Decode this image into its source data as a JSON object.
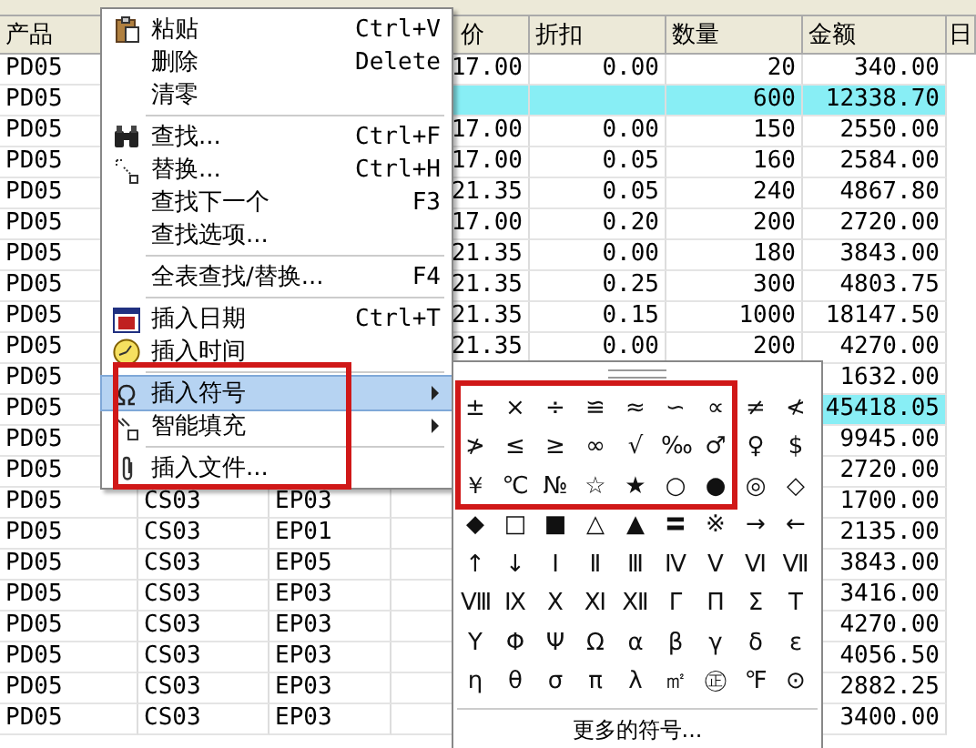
{
  "table": {
    "columns": [
      "产品",
      "",
      "",
      "价",
      "折扣",
      "数量",
      "金额",
      "日"
    ],
    "rows": [
      {
        "product": "PD05",
        "price": "17.00",
        "discount": "0.00",
        "qty": "20",
        "amount": "340.00",
        "highlighted": false
      },
      {
        "product": "PD05",
        "qty": "600",
        "amount": "12338.70",
        "highlighted": true
      },
      {
        "product": "PD05",
        "price": "17.00",
        "discount": "0.00",
        "qty": "150",
        "amount": "2550.00",
        "highlighted": false
      },
      {
        "product": "PD05",
        "price": "17.00",
        "discount": "0.05",
        "qty": "160",
        "amount": "2584.00",
        "highlighted": false
      },
      {
        "product": "PD05",
        "price": "21.35",
        "discount": "0.05",
        "qty": "240",
        "amount": "4867.80",
        "highlighted": false
      },
      {
        "product": "PD05",
        "price": "17.00",
        "discount": "0.20",
        "qty": "200",
        "amount": "2720.00",
        "highlighted": false
      },
      {
        "product": "PD05",
        "price": "21.35",
        "discount": "0.00",
        "qty": "180",
        "amount": "3843.00",
        "highlighted": false
      },
      {
        "product": "PD05",
        "price": "21.35",
        "discount": "0.25",
        "qty": "300",
        "amount": "4803.75",
        "highlighted": false
      },
      {
        "product": "PD05",
        "price": "21.35",
        "discount": "0.15",
        "qty": "1000",
        "amount": "18147.50",
        "highlighted": false
      },
      {
        "product": "PD05",
        "price": "21.35",
        "discount": "0.00",
        "qty": "200",
        "amount": "4270.00",
        "highlighted": false
      },
      {
        "product": "PD05",
        "amount": "1632.00",
        "highlighted": false
      },
      {
        "product": "PD05",
        "amount": "45418.05",
        "highlighted": true
      },
      {
        "product": "PD05",
        "amount": "9945.00",
        "highlighted": false
      },
      {
        "product": "PD05",
        "amount": "2720.00",
        "highlighted": false
      },
      {
        "product": "PD05",
        "col_2": "CS03",
        "col_3": "EP03",
        "amount": "1700.00",
        "highlighted": false
      },
      {
        "product": "PD05",
        "col_2": "CS03",
        "col_3": "EP01",
        "amount": "2135.00",
        "highlighted": false
      },
      {
        "product": "PD05",
        "col_2": "CS03",
        "col_3": "EP05",
        "amount": "3843.00",
        "highlighted": false
      },
      {
        "product": "PD05",
        "col_2": "CS03",
        "col_3": "EP03",
        "amount": "3416.00",
        "highlighted": false
      },
      {
        "product": "PD05",
        "col_2": "CS03",
        "col_3": "EP03",
        "amount": "4270.00",
        "highlighted": false
      },
      {
        "product": "PD05",
        "col_2": "CS03",
        "col_3": "EP03",
        "amount": "4056.50",
        "highlighted": false
      },
      {
        "product": "PD05",
        "col_2": "CS03",
        "col_3": "EP03",
        "amount": "2882.25",
        "highlighted": false
      },
      {
        "product": "PD05",
        "col_2": "CS03",
        "col_3": "EP03",
        "amount": "3400.00",
        "highlighted": false
      }
    ]
  },
  "context_menu": {
    "items": [
      {
        "kind": "item",
        "label": "粘贴",
        "shortcut": "Ctrl+V",
        "submenu": false,
        "selected": false
      },
      {
        "kind": "item",
        "label": "删除",
        "shortcut": "Delete",
        "submenu": false,
        "selected": false
      },
      {
        "kind": "item",
        "label": "清零",
        "submenu": false,
        "selected": false
      },
      {
        "kind": "separator"
      },
      {
        "kind": "item",
        "label": "查找...",
        "shortcut": "Ctrl+F",
        "submenu": false,
        "selected": false
      },
      {
        "kind": "item",
        "label": "替换...",
        "shortcut": "Ctrl+H",
        "submenu": false,
        "selected": false
      },
      {
        "kind": "item",
        "label": "查找下一个",
        "shortcut": "F3",
        "submenu": false,
        "selected": false
      },
      {
        "kind": "item",
        "label": "查找选项...",
        "submenu": false,
        "selected": false
      },
      {
        "kind": "separator"
      },
      {
        "kind": "item",
        "label": "全表查找/替换...",
        "shortcut": "F4",
        "submenu": false,
        "selected": false
      },
      {
        "kind": "separator"
      },
      {
        "kind": "item",
        "label": "插入日期",
        "shortcut": "Ctrl+T",
        "submenu": false,
        "selected": false
      },
      {
        "kind": "item",
        "label": "插入时间",
        "submenu": false,
        "selected": false
      },
      {
        "kind": "separator"
      },
      {
        "kind": "item",
        "label": "插入符号",
        "submenu": true,
        "selected": true
      },
      {
        "kind": "item",
        "label": "智能填充",
        "submenu": true,
        "selected": false
      },
      {
        "kind": "separator"
      },
      {
        "kind": "item",
        "label": "插入文件...",
        "submenu": false,
        "selected": false
      }
    ]
  },
  "symbol_palette": {
    "symbols": [
      "±",
      "×",
      "÷",
      "≌",
      "≈",
      "∽",
      "∝",
      "≠",
      "≮",
      "≯",
      "≤",
      "≥",
      "∞",
      "√",
      "‰",
      "♂",
      "♀",
      "$",
      "￥",
      "℃",
      "№",
      "☆",
      "★",
      "○",
      "●",
      "◎",
      "◇",
      "◆",
      "□",
      "■",
      "△",
      "▲",
      "〓",
      "※",
      "→",
      "←",
      "↑",
      "↓",
      "Ⅰ",
      "Ⅱ",
      "Ⅲ",
      "Ⅳ",
      "Ⅴ",
      "Ⅵ",
      "Ⅶ",
      "Ⅷ",
      "Ⅸ",
      "Ⅹ",
      "Ⅺ",
      "Ⅻ",
      "Γ",
      "Π",
      "Σ",
      "Τ",
      "Υ",
      "Φ",
      "Ψ",
      "Ω",
      "α",
      "β",
      "γ",
      "δ",
      "ε",
      "η",
      "θ",
      "σ",
      "π",
      "λ",
      "㎡",
      "㊣",
      "℉",
      "⊙"
    ],
    "more_button": "更多的符号..."
  }
}
